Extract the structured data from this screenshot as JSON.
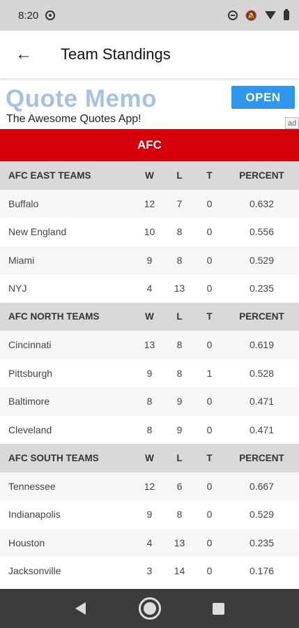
{
  "status_bar": {
    "time": "8:20"
  },
  "app_bar": {
    "back_icon": "arrow-left-icon",
    "title": "Team Standings"
  },
  "ad": {
    "title": "Quote Memo",
    "subtitle": "The Awesome Quotes App!",
    "button": "OPEN",
    "badge": "ad"
  },
  "conference": "AFC",
  "columns": {
    "w": "W",
    "l": "L",
    "t": "T",
    "pct": "PERCENT"
  },
  "divisions": [
    {
      "name": "AFC EAST TEAMS",
      "teams": [
        {
          "team": "Buffalo",
          "w": "12",
          "l": "7",
          "t": "0",
          "pct": "0.632"
        },
        {
          "team": "New England",
          "w": "10",
          "l": "8",
          "t": "0",
          "pct": "0.556"
        },
        {
          "team": "Miami",
          "w": "9",
          "l": "8",
          "t": "0",
          "pct": "0.529"
        },
        {
          "team": "NYJ",
          "w": "4",
          "l": "13",
          "t": "0",
          "pct": "0.235"
        }
      ]
    },
    {
      "name": "AFC NORTH TEAMS",
      "teams": [
        {
          "team": "Cincinnati",
          "w": "13",
          "l": "8",
          "t": "0",
          "pct": "0.619"
        },
        {
          "team": "Pittsburgh",
          "w": "9",
          "l": "8",
          "t": "1",
          "pct": "0.528"
        },
        {
          "team": "Baltimore",
          "w": "8",
          "l": "9",
          "t": "0",
          "pct": "0.471"
        },
        {
          "team": "Cleveland",
          "w": "8",
          "l": "9",
          "t": "0",
          "pct": "0.471"
        }
      ]
    },
    {
      "name": "AFC SOUTH TEAMS",
      "teams": [
        {
          "team": "Tennessee",
          "w": "12",
          "l": "6",
          "t": "0",
          "pct": "0.667"
        },
        {
          "team": "Indianapolis",
          "w": "9",
          "l": "8",
          "t": "0",
          "pct": "0.529"
        },
        {
          "team": "Houston",
          "w": "4",
          "l": "13",
          "t": "0",
          "pct": "0.235"
        },
        {
          "team": "Jacksonville",
          "w": "3",
          "l": "14",
          "t": "0",
          "pct": "0.176"
        }
      ]
    }
  ],
  "colors": {
    "header_red": "#d6000b",
    "ad_button": "#2f98ee",
    "ad_title": "#a8c1de"
  }
}
